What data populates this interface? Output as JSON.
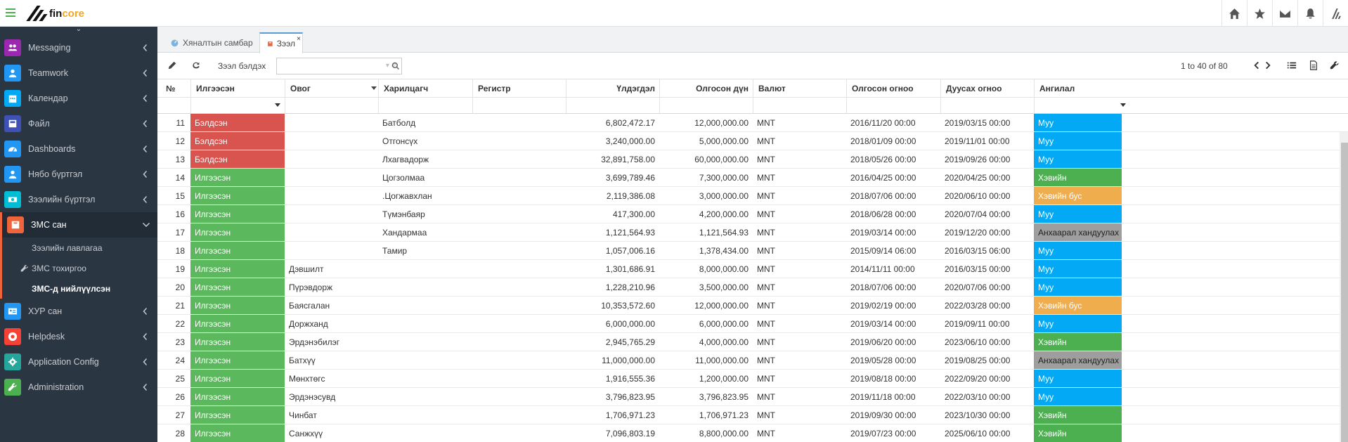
{
  "brand": {
    "name_part1": "fin",
    "name_part2": "core"
  },
  "top_icons": [
    "home-icon",
    "star-icon",
    "envelope-icon",
    "bell-icon",
    "logo-icon"
  ],
  "sidebar": {
    "items": [
      {
        "label": "Messaging",
        "icon": "users-icon",
        "color": "#9c27b0"
      },
      {
        "label": "Teamwork",
        "icon": "user-icon",
        "color": "#2196f3"
      },
      {
        "label": "Календар",
        "icon": "calendar-icon",
        "color": "#03a9f4"
      },
      {
        "label": "Файл",
        "icon": "file-icon",
        "color": "#3f51b5"
      },
      {
        "label": "Dashboards",
        "icon": "dashboard-icon",
        "color": "#2196f3"
      },
      {
        "label": "Нябо бүртгэл",
        "icon": "user-icon",
        "color": "#2196f3"
      },
      {
        "label": "Зээлийн бүртгэл",
        "icon": "money-icon",
        "color": "#00bcd4"
      },
      {
        "label": "ЗМС сан",
        "icon": "book-icon",
        "color": "#f0643c"
      }
    ],
    "subitems": [
      {
        "label": "Зээлийн лавлагаа"
      },
      {
        "label": "ЗМС тохиргоо"
      },
      {
        "label": "ЗМС-д нийлүүлсэн"
      }
    ],
    "items_after": [
      {
        "label": "ХУР сан",
        "icon": "id-card-icon",
        "color": "#2196f3"
      },
      {
        "label": "Helpdesk",
        "icon": "lifebuoy-icon",
        "color": "#f44336"
      },
      {
        "label": "Application Config",
        "icon": "gear-icon",
        "color": "#26a69a"
      },
      {
        "label": "Administration",
        "icon": "wrench-icon",
        "color": "#4caf50"
      }
    ]
  },
  "tabs": [
    {
      "label": "Хяналтын самбар"
    },
    {
      "label": "Зээл",
      "close": "×"
    }
  ],
  "toolbar": {
    "label": "Зээл бэлдэх",
    "search_value": ""
  },
  "pager": {
    "text": "1 to 40 of 80"
  },
  "columns": [
    "№",
    "Илгээсэн",
    "Овог",
    "Харилцагч",
    "Регистр",
    "Үлдэгдэл",
    "Олгосон дүн",
    "Валют",
    "Олгосон огноо",
    "Дуусах огноо",
    "Ангилал"
  ],
  "rows": [
    {
      "n": "11",
      "status": "Бэлдсэн",
      "st": "red",
      "last": "",
      "client": "Батболд",
      "reg": "",
      "bal": "6,802,472.17",
      "amt": "12,000,000.00",
      "cur": "MNT",
      "od": "2016/11/20 00:00",
      "ed": "2019/03/15 00:00",
      "cat": "Муу",
      "cc": "blue"
    },
    {
      "n": "12",
      "status": "Бэлдсэн",
      "st": "red",
      "last": "",
      "client": "Отгонсүх",
      "reg": "",
      "bal": "3,240,000.00",
      "amt": "5,000,000.00",
      "cur": "MNT",
      "od": "2018/01/09 00:00",
      "ed": "2019/11/01 00:00",
      "cat": "Муу",
      "cc": "blue"
    },
    {
      "n": "13",
      "status": "Бэлдсэн",
      "st": "red",
      "last": "",
      "client": "Лхагвадорж",
      "reg": "",
      "bal": "32,891,758.00",
      "amt": "60,000,000.00",
      "cur": "MNT",
      "od": "2018/05/26 00:00",
      "ed": "2019/09/26 00:00",
      "cat": "Муу",
      "cc": "blue"
    },
    {
      "n": "14",
      "status": "Илгээсэн",
      "st": "green",
      "last": "",
      "client": "Цогзолмаа",
      "reg": "",
      "bal": "3,699,789.46",
      "amt": "7,300,000.00",
      "cur": "MNT",
      "od": "2016/04/25 00:00",
      "ed": "2020/04/25 00:00",
      "cat": "Хэвийн",
      "cc": "green"
    },
    {
      "n": "15",
      "status": "Илгээсэн",
      "st": "green",
      "last": "",
      "client": ".Цогжавхлан",
      "reg": "",
      "bal": "2,119,386.08",
      "amt": "3,000,000.00",
      "cur": "MNT",
      "od": "2018/07/06 00:00",
      "ed": "2020/06/10 00:00",
      "cat": "Хэвийн бус",
      "cc": "orange"
    },
    {
      "n": "16",
      "status": "Илгээсэн",
      "st": "green",
      "last": "",
      "client": "Түмэнбаяр",
      "reg": "",
      "bal": "417,300.00",
      "amt": "4,200,000.00",
      "cur": "MNT",
      "od": "2018/06/28 00:00",
      "ed": "2020/07/04 00:00",
      "cat": "Муу",
      "cc": "blue"
    },
    {
      "n": "17",
      "status": "Илгээсэн",
      "st": "green",
      "last": "",
      "client": "Хандармаа",
      "reg": "",
      "bal": "1,121,564.93",
      "amt": "1,121,564.93",
      "cur": "MNT",
      "od": "2019/03/14 00:00",
      "ed": "2019/12/20 00:00",
      "cat": "Анхаарал хандуулах",
      "cc": "gray"
    },
    {
      "n": "18",
      "status": "Илгээсэн",
      "st": "green",
      "last": "",
      "client": "Тамир",
      "reg": "",
      "bal": "1,057,006.16",
      "amt": "1,378,434.00",
      "cur": "MNT",
      "od": "2015/09/14 06:00",
      "ed": "2016/03/15 06:00",
      "cat": "Муу",
      "cc": "blue"
    },
    {
      "n": "19",
      "status": "Илгээсэн",
      "st": "green",
      "last": "Дэвшилт",
      "client": "",
      "reg": "",
      "bal": "1,301,686.91",
      "amt": "8,000,000.00",
      "cur": "MNT",
      "od": "2014/11/11 00:00",
      "ed": "2016/03/15 00:00",
      "cat": "Муу",
      "cc": "blue"
    },
    {
      "n": "20",
      "status": "Илгээсэн",
      "st": "green",
      "last": "Пүрэвдорж",
      "client": "",
      "reg": "",
      "bal": "1,228,210.96",
      "amt": "3,500,000.00",
      "cur": "MNT",
      "od": "2018/07/06 00:00",
      "ed": "2020/07/06 00:00",
      "cat": "Муу",
      "cc": "blue"
    },
    {
      "n": "21",
      "status": "Илгээсэн",
      "st": "green",
      "last": "Баясгалан",
      "client": "",
      "reg": "",
      "bal": "10,353,572.60",
      "amt": "12,000,000.00",
      "cur": "MNT",
      "od": "2019/02/19 00:00",
      "ed": "2022/03/28 00:00",
      "cat": "Хэвийн бус",
      "cc": "orange"
    },
    {
      "n": "22",
      "status": "Илгээсэн",
      "st": "green",
      "last": "Доржханд",
      "client": "",
      "reg": "",
      "bal": "6,000,000.00",
      "amt": "6,000,000.00",
      "cur": "MNT",
      "od": "2019/03/14 00:00",
      "ed": "2019/09/11 00:00",
      "cat": "Муу",
      "cc": "blue"
    },
    {
      "n": "23",
      "status": "Илгээсэн",
      "st": "green",
      "last": "Эрдэнэбилэг",
      "client": "",
      "reg": "",
      "bal": "2,945,765.29",
      "amt": "4,000,000.00",
      "cur": "MNT",
      "od": "2019/06/20 00:00",
      "ed": "2023/06/10 00:00",
      "cat": "Хэвийн",
      "cc": "green"
    },
    {
      "n": "24",
      "status": "Илгээсэн",
      "st": "green",
      "last": "Батхүү",
      "client": "",
      "reg": "",
      "bal": "11,000,000.00",
      "amt": "11,000,000.00",
      "cur": "MNT",
      "od": "2019/05/28 00:00",
      "ed": "2019/08/25 00:00",
      "cat": "Анхаарал хандуулах",
      "cc": "gray"
    },
    {
      "n": "25",
      "status": "Илгээсэн",
      "st": "green",
      "last": "Мөнхтөгс",
      "client": "",
      "reg": "",
      "bal": "1,916,555.36",
      "amt": "1,200,000.00",
      "cur": "MNT",
      "od": "2019/08/18 00:00",
      "ed": "2022/09/20 00:00",
      "cat": "Муу",
      "cc": "blue"
    },
    {
      "n": "26",
      "status": "Илгээсэн",
      "st": "green",
      "last": "Эрдэнэсувд",
      "client": "",
      "reg": "",
      "bal": "3,796,823.95",
      "amt": "3,796,823.95",
      "cur": "MNT",
      "od": "2019/11/18 00:00",
      "ed": "2022/03/10 00:00",
      "cat": "Муу",
      "cc": "blue"
    },
    {
      "n": "27",
      "status": "Илгээсэн",
      "st": "green",
      "last": "Чинбат",
      "client": "",
      "reg": "",
      "bal": "1,706,971.23",
      "amt": "1,706,971.23",
      "cur": "MNT",
      "od": "2019/09/30 00:00",
      "ed": "2023/10/30 00:00",
      "cat": "Хэвийн",
      "cc": "green"
    },
    {
      "n": "28",
      "status": "Илгээсэн",
      "st": "green",
      "last": "Санжхүү",
      "client": "",
      "reg": "",
      "bal": "7,096,803.19",
      "amt": "8,800,000.00",
      "cur": "MNT",
      "od": "2019/07/23 00:00",
      "ed": "2025/06/10 00:00",
      "cat": "Хэвийн",
      "cc": "green"
    }
  ]
}
